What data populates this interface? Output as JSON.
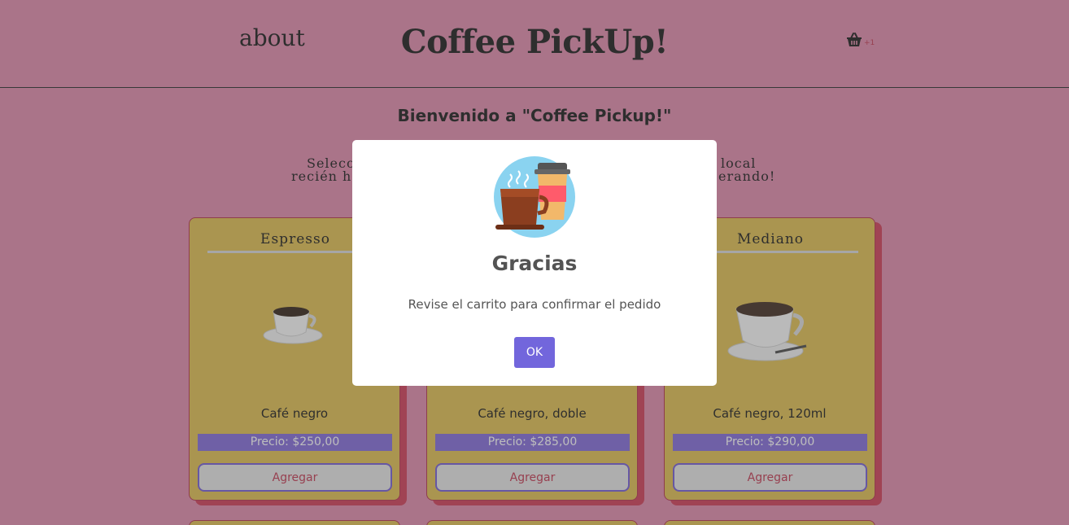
{
  "header": {
    "about_label": "about",
    "brand": "Coffee PickUp!",
    "cart_icon": "basket-icon",
    "cart_count": "+1"
  },
  "welcome": "Bienvenido a \"Coffee Pickup!\"",
  "intro": {
    "line1_left": "Selecci",
    "line1_right": "local",
    "line2_left": "recién he",
    "line2_right": "erando!"
  },
  "products": [
    {
      "title": "Espresso",
      "description": "Café negro",
      "price": "Precio: $250,00",
      "button": "Agregar"
    },
    {
      "title": "",
      "description": "Café negro, doble",
      "price": "Precio: $285,00",
      "button": "Agregar"
    },
    {
      "title": "Mediano",
      "description": "Café negro, 120ml",
      "price": "Precio: $290,00",
      "button": "Agregar"
    }
  ],
  "modal": {
    "icon": "coffee-cups-icon",
    "title": "Gracias",
    "text": "Revise el carrito para confirmar el pedido",
    "ok_label": "OK"
  },
  "colors": {
    "background": "#df86a9",
    "card": "#e0bd4a",
    "card_shadow": "#cf3551",
    "price_bar": "#7d65d9",
    "button_text": "#c0304a",
    "modal_button": "#7266dc"
  }
}
